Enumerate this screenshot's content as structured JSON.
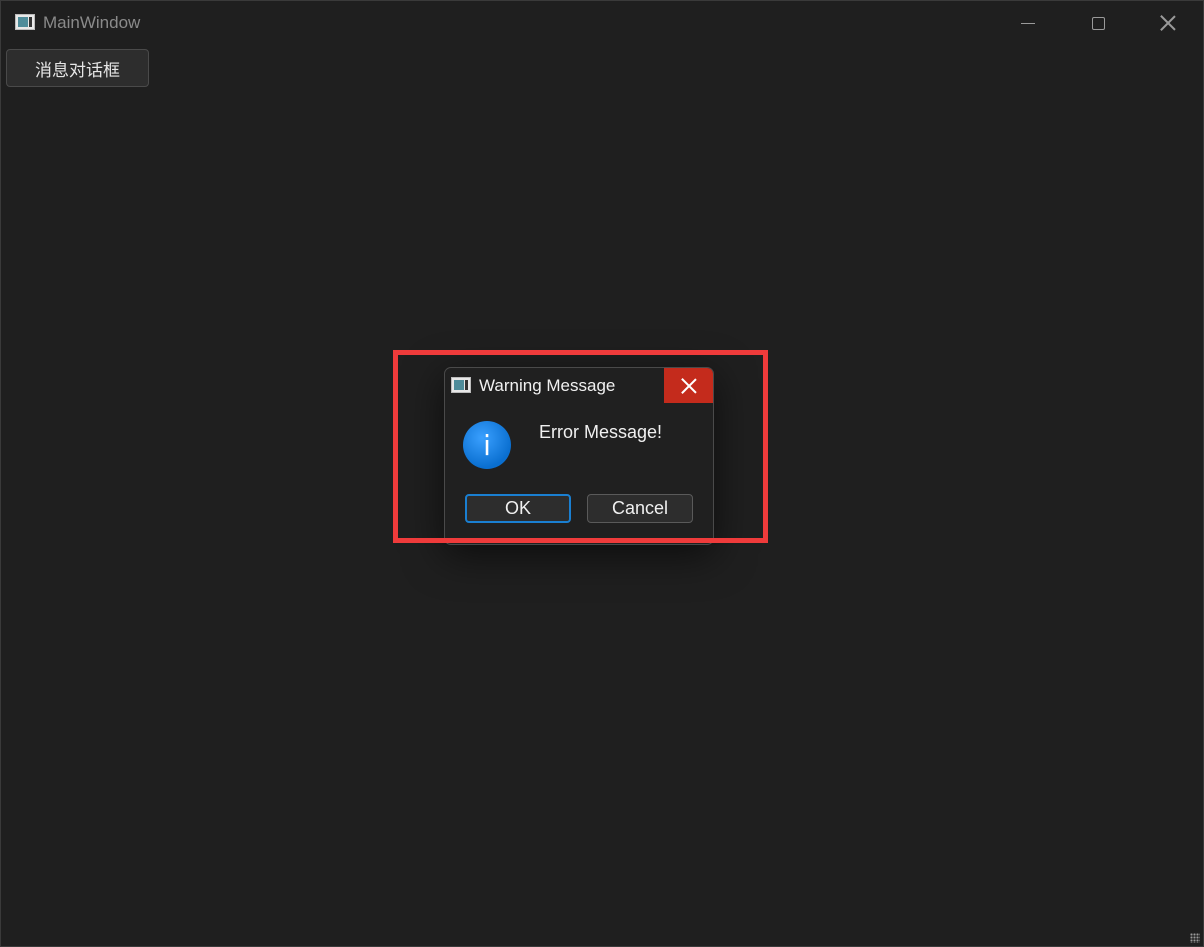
{
  "window": {
    "title": "MainWindow",
    "icons": {
      "app": "app-icon",
      "minimize": "minimize-icon",
      "maximize": "maximize-icon",
      "close": "close-icon"
    }
  },
  "toolbar": {
    "message_dialog_button": "消息对话框"
  },
  "dialog": {
    "title": "Warning Message",
    "message": "Error Message!",
    "info_icon_glyph": "i",
    "ok_label": "OK",
    "cancel_label": "Cancel",
    "icons": {
      "app": "app-icon",
      "close": "close-icon",
      "info": "info-icon"
    },
    "highlight_color": "#ef3b3b"
  },
  "colors": {
    "background": "#1f1f1f",
    "close_hover": "#c42b1c",
    "focus_accent": "#1a7fd1"
  }
}
